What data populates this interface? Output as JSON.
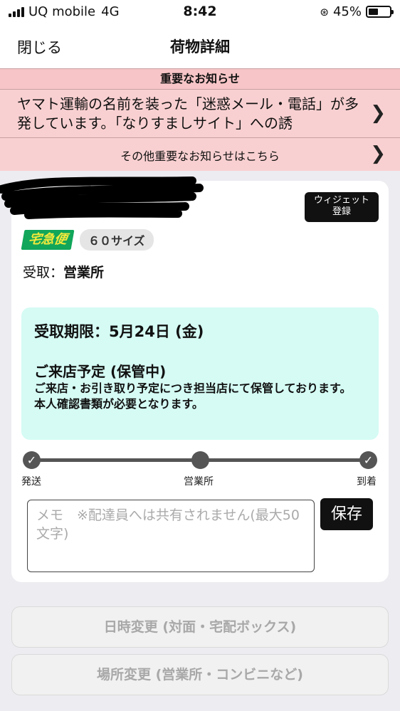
{
  "status_bar": {
    "carrier": "UQ mobile",
    "network": "4G",
    "time": "8:42",
    "battery_text": "45%",
    "battery_level": 0.45,
    "icons": [
      "signal-icon",
      "orientation-lock-icon",
      "battery-icon"
    ]
  },
  "nav": {
    "close_label": "閉じる",
    "title": "荷物詳細"
  },
  "notice": {
    "header": "重要なお知らせ",
    "main_text": "ヤマト運輸の名前を装った「迷惑メール・電話」が多発しています。「なりすましサイト」への誘",
    "more_text": "その他重要なお知らせはこちら",
    "background_color": "#f9d0d1"
  },
  "parcel": {
    "widget_button_lines": [
      "ウィジェット",
      "登録"
    ],
    "service_logo": "宅急便",
    "size": "６０サイズ",
    "receive_label": "受取：",
    "receive_value": "営業所",
    "deadline": "受取期限：5月24日 (金)",
    "status_title": "ご来店予定 (保管中)",
    "status_lines": [
      "ご来店・お引き取り予定につき担当店にて保管しております。",
      "本人確認書類が必要となります。"
    ],
    "status_box_color": "#d5fbf4"
  },
  "progress": {
    "steps": [
      {
        "label": "発送",
        "state": "done"
      },
      {
        "label": "営業所",
        "state": "current"
      },
      {
        "label": "到着",
        "state": "done"
      }
    ]
  },
  "memo": {
    "placeholder": "メモ　※配達員へは共有されません(最大50文字)",
    "value": "",
    "save_label": "保存"
  },
  "actions": {
    "change_datetime": "日時変更 (対面・宅配ボックス)",
    "change_location": "場所変更 (営業所・コンビニなど)"
  }
}
